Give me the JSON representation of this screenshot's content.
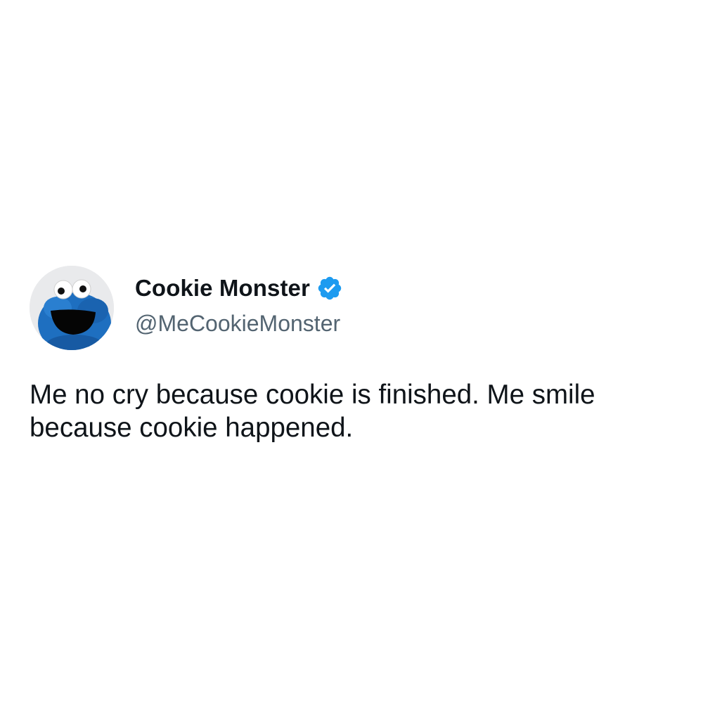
{
  "tweet": {
    "author": {
      "display_name": "Cookie Monster",
      "handle": "@MeCookieMonster",
      "verified": true,
      "avatar_icon": "cookie-monster-avatar"
    },
    "text": "Me no cry because cookie is finished. Me smile because cookie happened."
  },
  "colors": {
    "verified_badge": "#1d9bf0",
    "handle_text": "#536471",
    "body_text": "#0f1419",
    "avatar_fur": "#1e6fc0"
  }
}
